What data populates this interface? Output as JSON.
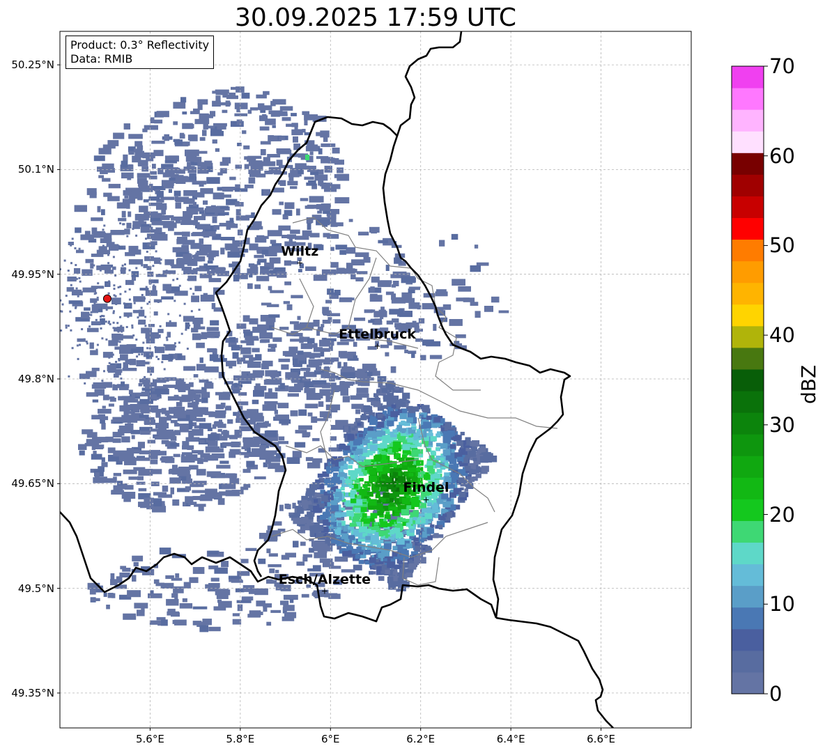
{
  "title": "30.09.2025 17:59 UTC",
  "info": {
    "product": "Product: 0.3° Reflectivity",
    "data": "Data: RMIB"
  },
  "axes": {
    "lat_ticks": [
      "50.25°N",
      "50.1°N",
      "49.95°N",
      "49.8°N",
      "49.65°N",
      "49.5°N",
      "49.35°N"
    ],
    "lon_ticks": [
      "5.6°E",
      "5.8°E",
      "6°E",
      "6.2°E",
      "6.4°E",
      "6.6°E"
    ]
  },
  "cities": [
    {
      "name": "Wiltz",
      "lat": 49.966,
      "lon": 5.932
    },
    {
      "name": "Ettelbruck",
      "lat": 49.847,
      "lon": 6.104
    },
    {
      "name": "Findel",
      "lat": 49.627,
      "lon": 6.212
    },
    {
      "name": "Esch/Alzette",
      "lat": 49.496,
      "lon": 5.987
    }
  ],
  "radar_site": {
    "lat": 49.915,
    "lon": 5.505,
    "color": "#e31414"
  },
  "colorbar": {
    "label": "dBZ",
    "ticks": [
      "70",
      "60",
      "50",
      "40",
      "30",
      "20",
      "10",
      "0"
    ],
    "min": 0,
    "max": 70,
    "step": 2.5,
    "colors": [
      "#6474a4",
      "#586ca0",
      "#4a5f9f",
      "#4a78b4",
      "#5a9ec8",
      "#64bcd8",
      "#5ed8c8",
      "#3ed874",
      "#14c81e",
      "#12b814",
      "#10a810",
      "#0e960e",
      "#0c840c",
      "#0a720a",
      "#085e08",
      "#487810",
      "#b0b40a",
      "#ffd400",
      "#ffb400",
      "#ff9c00",
      "#ff7c00",
      "#ff0000",
      "#c80000",
      "#a00000",
      "#780000",
      "#ffe0ff",
      "#ffb4ff",
      "#ff78ff",
      "#f040f0"
    ]
  },
  "precip_cell": {
    "center_lat": 49.66,
    "center_lon": 6.13,
    "peak_dbz": 33
  }
}
